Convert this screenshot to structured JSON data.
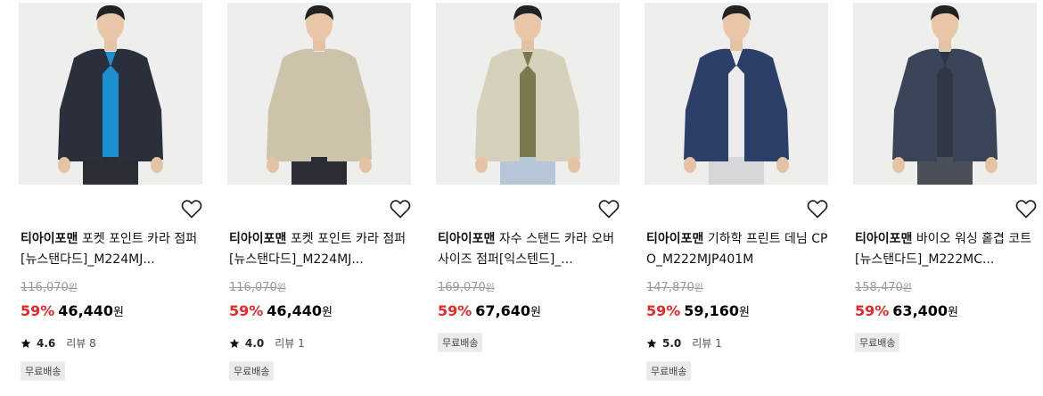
{
  "products": [
    {
      "brand": "티아이포맨",
      "name": "포켓 포인트 카라 점퍼[뉴스탠다드]_M224MJ...",
      "original_price": "116,070",
      "discount": "59%",
      "price": "46,440",
      "currency": "원",
      "rating": "4.6",
      "reviews": "리뷰 8",
      "badge": "무료배송",
      "jacket_color": "#2b2f3c",
      "inner_color": "#1b8fd0",
      "pants_color": "#2a2d33"
    },
    {
      "brand": "티아이포맨",
      "name": "포켓 포인트 카라 점퍼[뉴스탠다드]_M224MJ...",
      "original_price": "116,070",
      "discount": "59%",
      "price": "46,440",
      "currency": "원",
      "rating": "4.0",
      "reviews": "리뷰 1",
      "badge": "무료배송",
      "jacket_color": "#cdc3ab",
      "inner_color": "#cdc3ab",
      "pants_color": "#2a2d33"
    },
    {
      "brand": "티아이포맨",
      "name": "자수 스탠드 카라 오버 사이즈 점퍼[익스텐드]_...",
      "original_price": "169,070",
      "discount": "59%",
      "price": "67,640",
      "currency": "원",
      "badge": "무료배송",
      "jacket_color": "#d6d1bd",
      "inner_color": "#7a7a4e",
      "pants_color": "#b4c6d8"
    },
    {
      "brand": "티아이포맨",
      "name": "기하학 프린트 데님 CPO_M222MJP401M",
      "original_price": "147,870",
      "discount": "59%",
      "price": "59,160",
      "currency": "원",
      "rating": "5.0",
      "reviews": "리뷰 1",
      "badge": "무료배송",
      "jacket_color": "#2c3f69",
      "inner_color": "#ececec",
      "pants_color": "#d7d7d9"
    },
    {
      "brand": "티아이포맨",
      "name": "바이오 워싱 홑겹 코트[뉴스탠다드]_M222MC...",
      "original_price": "158,470",
      "discount": "59%",
      "price": "63,400",
      "currency": "원",
      "badge": "무료배송",
      "jacket_color": "#3a4458",
      "inner_color": "#2f3644",
      "pants_color": "#4a4f58"
    }
  ],
  "icons": {
    "wishlist": "heart-outline-icon",
    "rating": "star-icon"
  }
}
